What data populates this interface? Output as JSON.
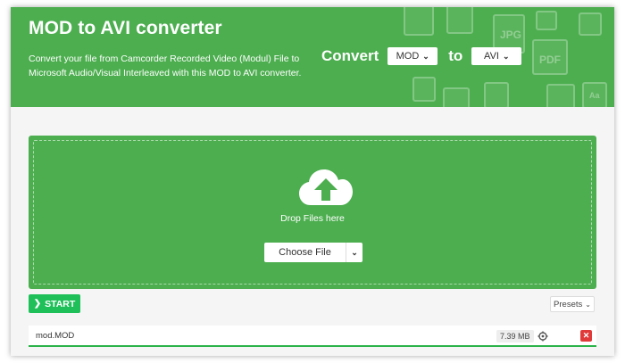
{
  "header": {
    "title": "MOD to AVI converter",
    "description": "Convert your file from Camcorder Recorded Video (Modul) File to Microsoft Audio/Visual Interleaved with this MOD to AVI converter.",
    "convert_label": "Convert",
    "to_label": "to",
    "from_format": "MOD",
    "to_format": "AVI",
    "deco_labels": [
      "JPG",
      "PDF",
      "Aa"
    ]
  },
  "dropzone": {
    "text": "Drop Files here",
    "choose_file_label": "Choose File"
  },
  "toolbar": {
    "start_label": "START",
    "presets_label": "Presets"
  },
  "file": {
    "name": "mod.MOD",
    "size": "7.39 MB"
  },
  "colors": {
    "brand_green": "#4cae4f",
    "start_green": "#1fc05a",
    "delete_red": "#e03a3a"
  },
  "icons": {
    "upload": "cloud-upload-icon",
    "settings": "settings-icon",
    "delete": "close-icon",
    "start": "chevron-right-icon",
    "dropdown": "chevron-down-icon"
  }
}
